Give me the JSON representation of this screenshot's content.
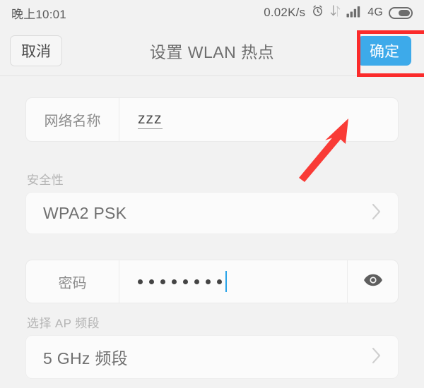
{
  "status_bar": {
    "time": "晚上10:01",
    "net_speed": "0.02K/s",
    "network_type": "4G",
    "icons": [
      "alarm-clock-icon",
      "data-transfer-icon",
      "signal-bars-icon",
      "battery-icon"
    ]
  },
  "header": {
    "cancel_label": "取消",
    "title": "设置 WLAN 热点",
    "confirm_label": "确定"
  },
  "form": {
    "ssid": {
      "label": "网络名称",
      "value": "zzz"
    },
    "security": {
      "section_label": "安全性",
      "value": "WPA2 PSK"
    },
    "password": {
      "label": "密码",
      "masked_value": "••••••••",
      "dot_count": 8,
      "reveal_icon": "eye-icon"
    },
    "ap_band": {
      "section_label": "选择 AP 频段",
      "value": "5 GHz 频段"
    }
  },
  "annotations": {
    "highlight_color": "#fb2b2b",
    "highlight_target": "确定",
    "arrow_color": "#f93b36",
    "arrow_target": "网络名称"
  },
  "colors": {
    "accent_blue": "#3daaea",
    "background": "#f2f2f2",
    "card": "#fbfbfb",
    "caret_blue": "#29a3e8"
  }
}
